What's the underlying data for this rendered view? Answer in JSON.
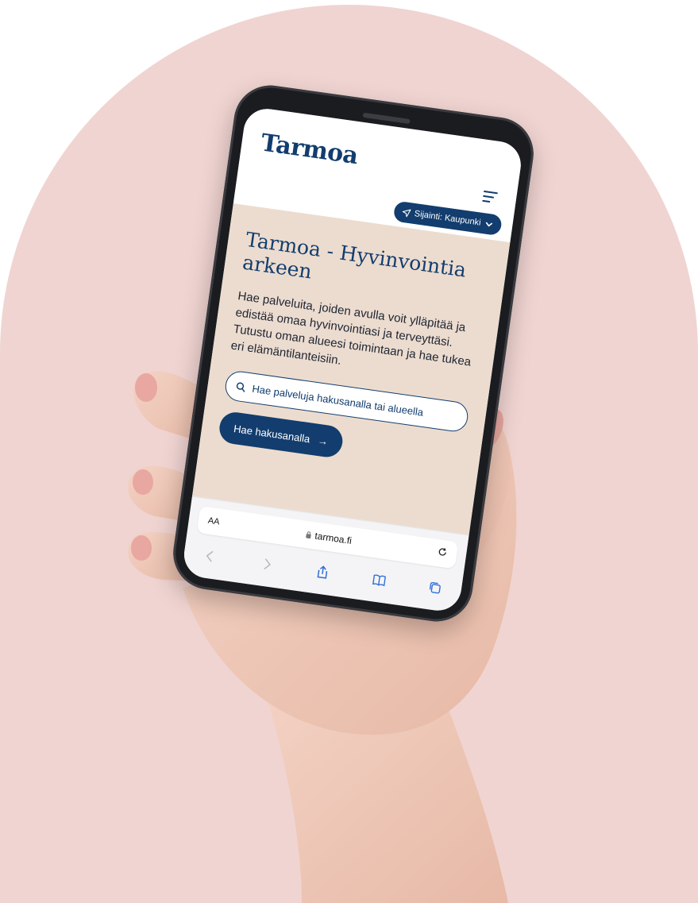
{
  "site": {
    "logo": "Tarmoa",
    "location_label": "Sijainti: Kaupunki"
  },
  "hero": {
    "title": "Tarmoa - Hyvinvointia arkeen",
    "text": "Hae palveluita, joiden avulla voit ylläpitää ja edistää omaa hyvinvointiasi ja terveyttäsi. Tutustu oman alueesi toimintaan ja hae tukea eri elämäntilanteisiin.",
    "search_placeholder": "Hae palveluja hakusanalla tai alueella",
    "search_button": "Hae hakusanalla",
    "search_button_arrow": "→"
  },
  "browser": {
    "text_size": "AA",
    "url": "tarmoa.fi",
    "icons": [
      "back-icon",
      "forward-icon",
      "share-icon",
      "bookmarks-icon",
      "tabs-icon",
      "reload-icon",
      "lock-icon"
    ]
  },
  "colors": {
    "background_arch": "#f0d4d1",
    "brand_navy": "#123d6e",
    "hero_beige": "#ecdccf"
  }
}
